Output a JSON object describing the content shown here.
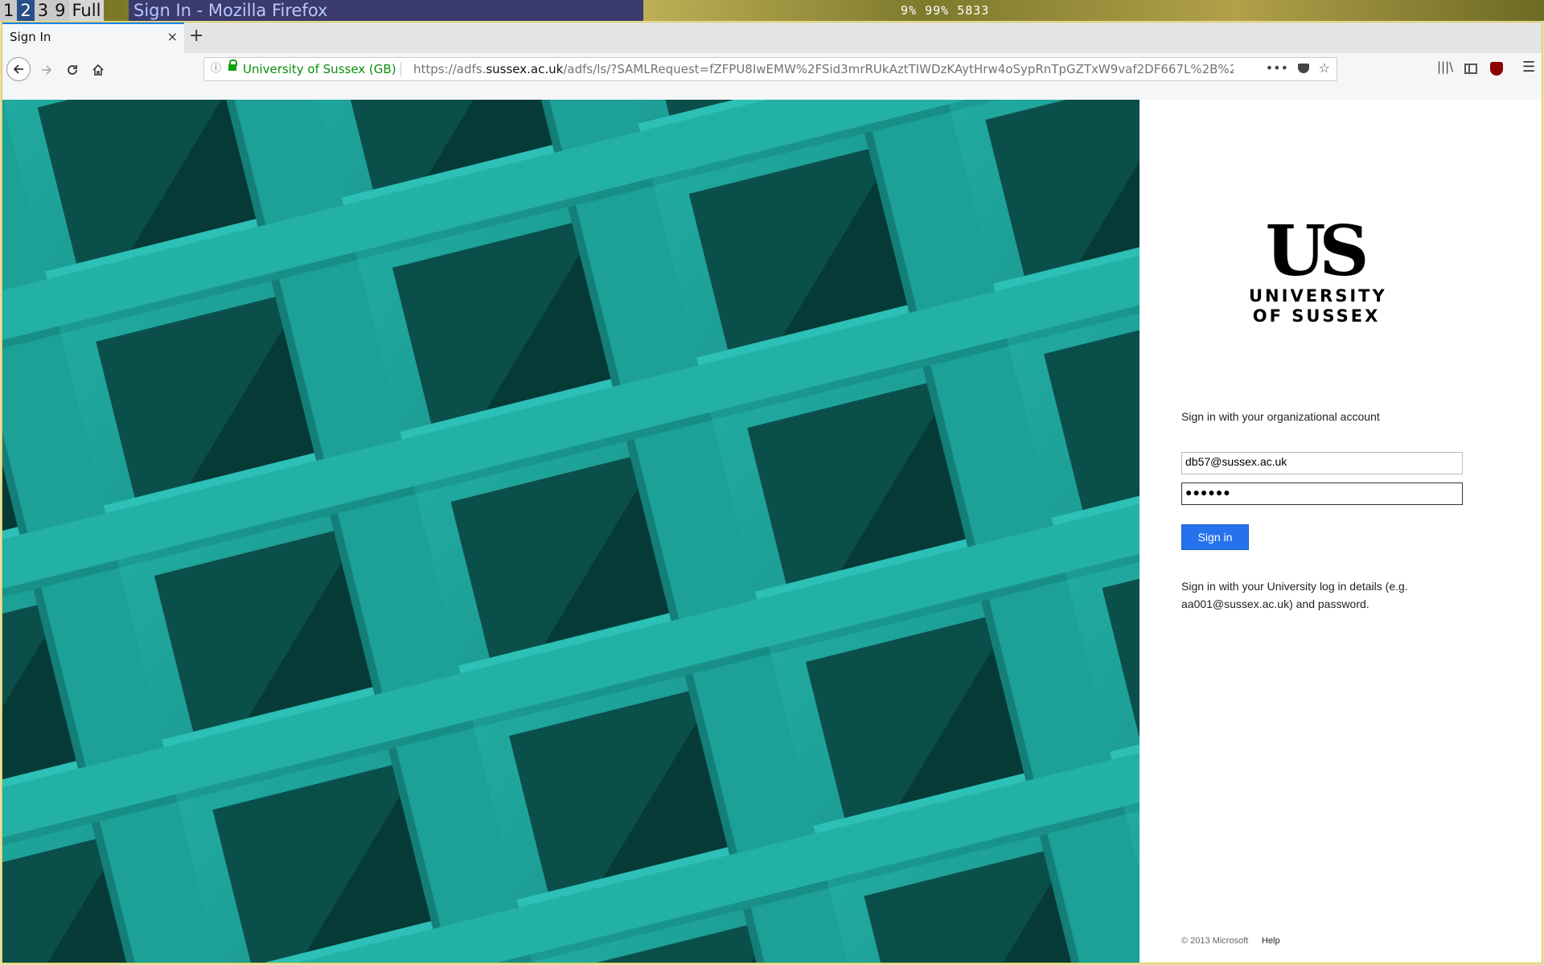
{
  "wm": {
    "workspaces": [
      "1",
      "2",
      "3",
      "9",
      "Full"
    ],
    "active_workspace": "2",
    "window_title": "Sign In - Mozilla Firefox",
    "status": "9%  99%  5833"
  },
  "browser": {
    "tab_title": "Sign In",
    "tab_close": "×",
    "new_tab": "+",
    "site_identity": "University of Sussex (GB)",
    "url_prefix": "https://adfs.",
    "url_domain": "sussex.ac.uk",
    "url_rest": "/adfs/ls/?SAMLRequest=fZFPU8IwEMW%2FSid3mrRUkAztTIWDzKAytHrw4oSypRnTpGZTxW9vaf2DF667L%2B%2",
    "icons": {
      "back": "arrow-left-icon",
      "forward": "arrow-right-icon",
      "reload": "reload-icon",
      "home": "home-icon",
      "info": "info-icon",
      "lock": "lock-icon",
      "more": "ellipsis-icon",
      "pocket": "pocket-icon",
      "bookmark": "star-icon",
      "library": "library-icon",
      "sidebar": "sidebar-icon",
      "ublock": "ublock-icon",
      "menu": "hamburger-menu-icon"
    }
  },
  "login": {
    "logo_monogram": "US",
    "logo_line1": "UNIVERSITY",
    "logo_line2": "OF SUSSEX",
    "heading": "Sign in with your organizational account",
    "email_value": "db57@sussex.ac.uk",
    "password_mask": "●●●●●●",
    "signin_label": "Sign in",
    "help_text": "Sign in with your University log in details (e.g. aa001@sussex.ac.uk) and password.",
    "footer_copyright": "© 2013 Microsoft",
    "footer_help": "Help"
  },
  "colors": {
    "accent_button": "#2672ec",
    "illustration_teal": "#1a9a92",
    "identity_green": "#0a8e0a"
  }
}
